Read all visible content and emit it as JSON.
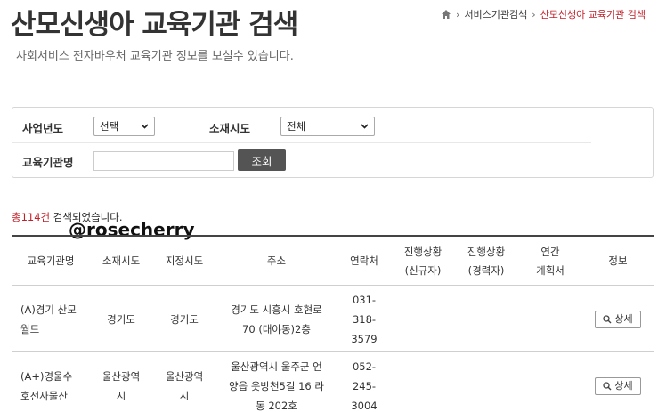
{
  "page": {
    "title": "산모신생아 교육기관 검색",
    "subtitle": "사회서비스 전자바우처 교육기관 정보를 보실수 있습니다."
  },
  "breadcrumb": {
    "items": [
      "서비스기관검색",
      "산모신생아 교육기관 검색"
    ]
  },
  "search": {
    "year_label": "사업년도",
    "year_value": "선택",
    "region_label": "소재시도",
    "region_value": "전체",
    "name_label": "교육기관명",
    "name_value": "",
    "search_button": "조회"
  },
  "results": {
    "prefix": "총",
    "count": "114건",
    "suffix": " 검색되었습니다."
  },
  "watermark": "@rosecherry",
  "table": {
    "headers": [
      "교육기관명",
      "소재시도",
      "지정시도",
      "주소",
      "연락처",
      "진행상황\n(신규자)",
      "진행상황\n(경력자)",
      "연간\n계획서",
      "정보"
    ],
    "rows": [
      {
        "name": "(A)경기 산모\n월드",
        "location": "경기도",
        "designated": "경기도",
        "address": "경기도 시흥시 호현로\n70 (대야동)2층",
        "phone": "031-\n318-\n3579",
        "new": "",
        "career": "",
        "plan": "",
        "detail": "상세"
      },
      {
        "name": "(A+)경울수\n호전사물산",
        "location": "울산광역\n시",
        "designated": "울산광역\n시",
        "address": "울산광역시 울주군 언\n양읍 읏방천5길 16 라\n동 202호",
        "phone": "052-\n245-\n3004",
        "new": "",
        "career": "",
        "plan": "",
        "detail": "상세"
      }
    ]
  },
  "colors": {
    "accent_red": "#c0202a",
    "button_dark": "#545454"
  }
}
